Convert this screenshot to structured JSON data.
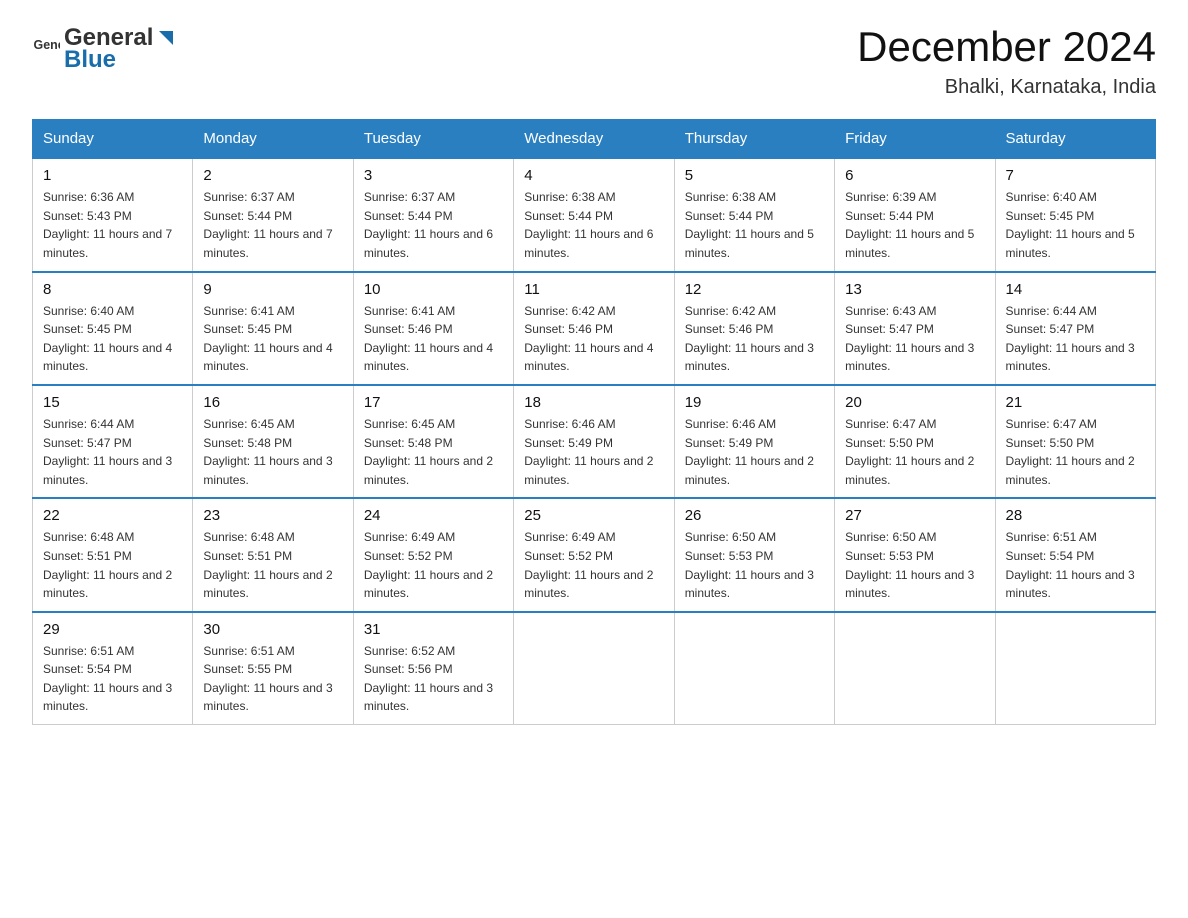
{
  "header": {
    "logo_general": "General",
    "logo_blue": "Blue",
    "month": "December 2024",
    "location": "Bhalki, Karnataka, India"
  },
  "days_of_week": [
    "Sunday",
    "Monday",
    "Tuesday",
    "Wednesday",
    "Thursday",
    "Friday",
    "Saturday"
  ],
  "weeks": [
    [
      {
        "day": "1",
        "sunrise": "6:36 AM",
        "sunset": "5:43 PM",
        "daylight": "11 hours and 7 minutes."
      },
      {
        "day": "2",
        "sunrise": "6:37 AM",
        "sunset": "5:44 PM",
        "daylight": "11 hours and 7 minutes."
      },
      {
        "day": "3",
        "sunrise": "6:37 AM",
        "sunset": "5:44 PM",
        "daylight": "11 hours and 6 minutes."
      },
      {
        "day": "4",
        "sunrise": "6:38 AM",
        "sunset": "5:44 PM",
        "daylight": "11 hours and 6 minutes."
      },
      {
        "day": "5",
        "sunrise": "6:38 AM",
        "sunset": "5:44 PM",
        "daylight": "11 hours and 5 minutes."
      },
      {
        "day": "6",
        "sunrise": "6:39 AM",
        "sunset": "5:44 PM",
        "daylight": "11 hours and 5 minutes."
      },
      {
        "day": "7",
        "sunrise": "6:40 AM",
        "sunset": "5:45 PM",
        "daylight": "11 hours and 5 minutes."
      }
    ],
    [
      {
        "day": "8",
        "sunrise": "6:40 AM",
        "sunset": "5:45 PM",
        "daylight": "11 hours and 4 minutes."
      },
      {
        "day": "9",
        "sunrise": "6:41 AM",
        "sunset": "5:45 PM",
        "daylight": "11 hours and 4 minutes."
      },
      {
        "day": "10",
        "sunrise": "6:41 AM",
        "sunset": "5:46 PM",
        "daylight": "11 hours and 4 minutes."
      },
      {
        "day": "11",
        "sunrise": "6:42 AM",
        "sunset": "5:46 PM",
        "daylight": "11 hours and 4 minutes."
      },
      {
        "day": "12",
        "sunrise": "6:42 AM",
        "sunset": "5:46 PM",
        "daylight": "11 hours and 3 minutes."
      },
      {
        "day": "13",
        "sunrise": "6:43 AM",
        "sunset": "5:47 PM",
        "daylight": "11 hours and 3 minutes."
      },
      {
        "day": "14",
        "sunrise": "6:44 AM",
        "sunset": "5:47 PM",
        "daylight": "11 hours and 3 minutes."
      }
    ],
    [
      {
        "day": "15",
        "sunrise": "6:44 AM",
        "sunset": "5:47 PM",
        "daylight": "11 hours and 3 minutes."
      },
      {
        "day": "16",
        "sunrise": "6:45 AM",
        "sunset": "5:48 PM",
        "daylight": "11 hours and 3 minutes."
      },
      {
        "day": "17",
        "sunrise": "6:45 AM",
        "sunset": "5:48 PM",
        "daylight": "11 hours and 2 minutes."
      },
      {
        "day": "18",
        "sunrise": "6:46 AM",
        "sunset": "5:49 PM",
        "daylight": "11 hours and 2 minutes."
      },
      {
        "day": "19",
        "sunrise": "6:46 AM",
        "sunset": "5:49 PM",
        "daylight": "11 hours and 2 minutes."
      },
      {
        "day": "20",
        "sunrise": "6:47 AM",
        "sunset": "5:50 PM",
        "daylight": "11 hours and 2 minutes."
      },
      {
        "day": "21",
        "sunrise": "6:47 AM",
        "sunset": "5:50 PM",
        "daylight": "11 hours and 2 minutes."
      }
    ],
    [
      {
        "day": "22",
        "sunrise": "6:48 AM",
        "sunset": "5:51 PM",
        "daylight": "11 hours and 2 minutes."
      },
      {
        "day": "23",
        "sunrise": "6:48 AM",
        "sunset": "5:51 PM",
        "daylight": "11 hours and 2 minutes."
      },
      {
        "day": "24",
        "sunrise": "6:49 AM",
        "sunset": "5:52 PM",
        "daylight": "11 hours and 2 minutes."
      },
      {
        "day": "25",
        "sunrise": "6:49 AM",
        "sunset": "5:52 PM",
        "daylight": "11 hours and 2 minutes."
      },
      {
        "day": "26",
        "sunrise": "6:50 AM",
        "sunset": "5:53 PM",
        "daylight": "11 hours and 3 minutes."
      },
      {
        "day": "27",
        "sunrise": "6:50 AM",
        "sunset": "5:53 PM",
        "daylight": "11 hours and 3 minutes."
      },
      {
        "day": "28",
        "sunrise": "6:51 AM",
        "sunset": "5:54 PM",
        "daylight": "11 hours and 3 minutes."
      }
    ],
    [
      {
        "day": "29",
        "sunrise": "6:51 AM",
        "sunset": "5:54 PM",
        "daylight": "11 hours and 3 minutes."
      },
      {
        "day": "30",
        "sunrise": "6:51 AM",
        "sunset": "5:55 PM",
        "daylight": "11 hours and 3 minutes."
      },
      {
        "day": "31",
        "sunrise": "6:52 AM",
        "sunset": "5:56 PM",
        "daylight": "11 hours and 3 minutes."
      },
      null,
      null,
      null,
      null
    ]
  ]
}
